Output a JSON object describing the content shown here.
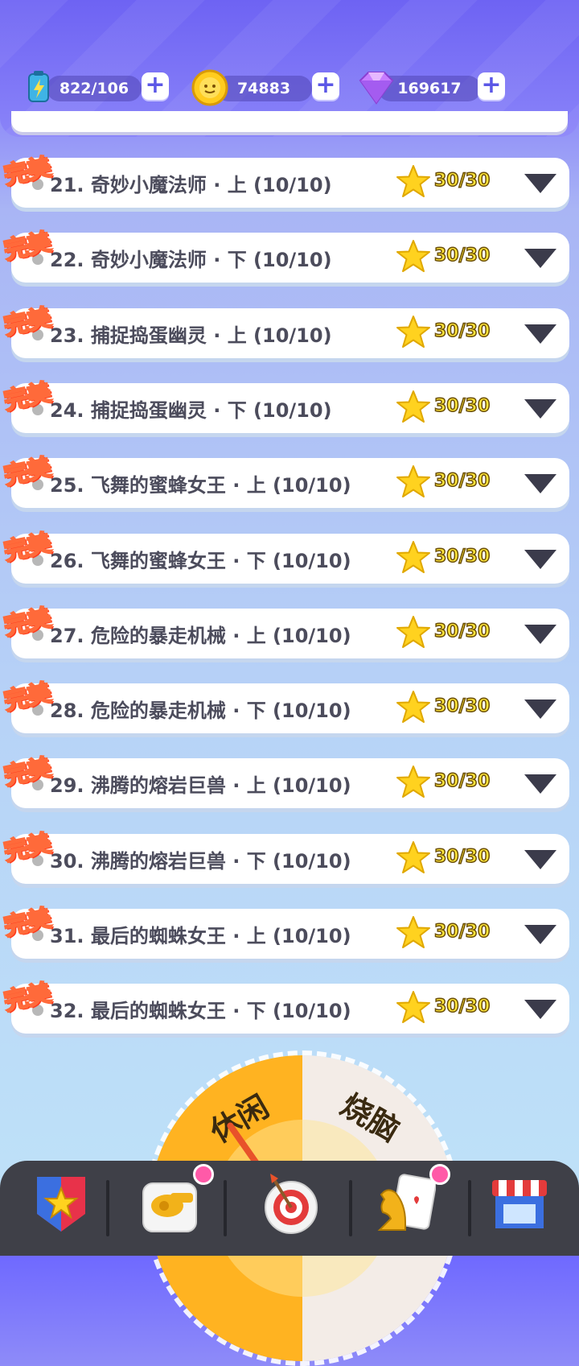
{
  "currencies": {
    "energy": {
      "value": "822/106",
      "icon": "battery-icon"
    },
    "coins": {
      "value": "74883",
      "icon": "coin-icon"
    },
    "gems": {
      "value": "169617",
      "icon": "gem-icon"
    }
  },
  "badge_label": "完美",
  "levels": [
    {
      "title": "21. 奇妙小魔法师 · 上 (10/10)",
      "score": "30/30"
    },
    {
      "title": "22. 奇妙小魔法师 · 下 (10/10)",
      "score": "30/30"
    },
    {
      "title": "23. 捕捉捣蛋幽灵 · 上 (10/10)",
      "score": "30/30"
    },
    {
      "title": "24. 捕捉捣蛋幽灵 · 下 (10/10)",
      "score": "30/30"
    },
    {
      "title": "25. 飞舞的蜜蜂女王 · 上 (10/10)",
      "score": "30/30"
    },
    {
      "title": "26. 飞舞的蜜蜂女王 · 下 (10/10)",
      "score": "30/30"
    },
    {
      "title": "27. 危险的暴走机械 · 上 (10/10)",
      "score": "30/30"
    },
    {
      "title": "28. 危险的暴走机械 · 下 (10/10)",
      "score": "30/30"
    },
    {
      "title": "29. 沸腾的熔岩巨兽 · 上 (10/10)",
      "score": "30/30"
    },
    {
      "title": "30. 沸腾的熔岩巨兽 · 下 (10/10)",
      "score": "30/30"
    },
    {
      "title": "31. 最后的蜘蛛女王 · 上 (10/10)",
      "score": "30/30"
    },
    {
      "title": "32. 最后的蜘蛛女王 · 下 (10/10)",
      "score": "30/30"
    }
  ],
  "mode_dial": {
    "left": "休闲",
    "right": "烧脑"
  },
  "nav": [
    {
      "icon": "badge-shield-icon",
      "notify": false
    },
    {
      "icon": "whistle-icon",
      "notify": true
    },
    {
      "icon": "target-icon",
      "notify": false
    },
    {
      "icon": "knight-card-icon",
      "notify": true
    },
    {
      "icon": "shop-icon",
      "notify": false
    }
  ],
  "colors": {
    "accent": "#6e63f3",
    "star": "#ffd21f",
    "badge": "#ff6a3a",
    "dial": "#ffb321"
  }
}
